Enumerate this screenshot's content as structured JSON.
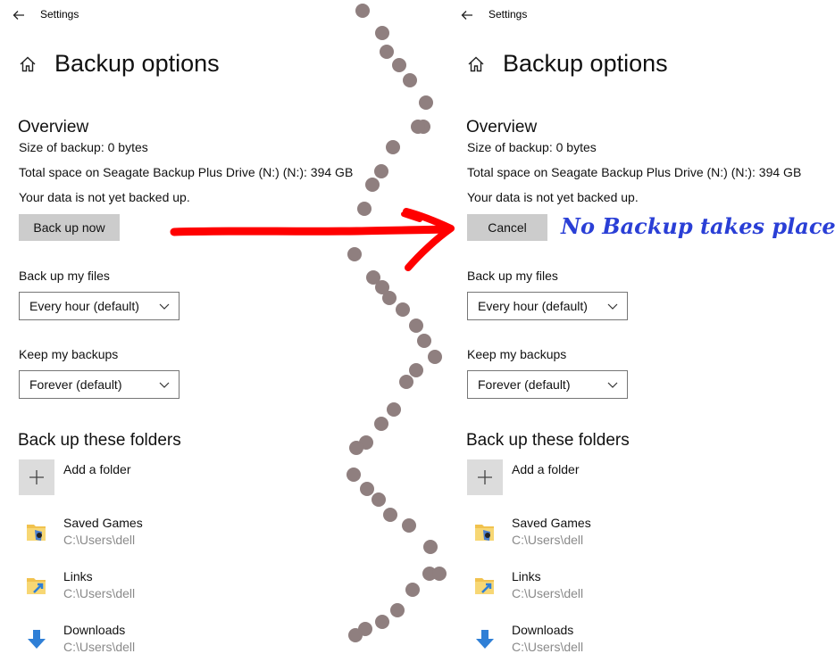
{
  "panels": {
    "left": {
      "app_title": "Settings",
      "page_title": "Backup options",
      "overview_title": "Overview",
      "size_of_backup": "Size of backup: 0 bytes",
      "total_space": "Total space on Seagate Backup Plus Drive (N:) (N:): 394 GB",
      "status": "Your data is not yet backed up.",
      "action_button": "Back up now",
      "backup_files_label": "Back up my files",
      "backup_files_value": "Every hour (default)",
      "keep_backups_label": "Keep my backups",
      "keep_backups_value": "Forever (default)",
      "folders_title": "Back up these folders",
      "add_folder": "Add a folder",
      "folders": [
        {
          "name": "Saved Games",
          "path": "C:\\Users\\dell"
        },
        {
          "name": "Links",
          "path": "C:\\Users\\dell"
        },
        {
          "name": "Downloads",
          "path": "C:\\Users\\dell"
        }
      ]
    },
    "right": {
      "app_title": "Settings",
      "page_title": "Backup options",
      "overview_title": "Overview",
      "size_of_backup": "Size of backup: 0 bytes",
      "total_space": "Total space on Seagate Backup Plus Drive (N:) (N:): 394 GB",
      "status": "Your data is not yet backed up.",
      "action_button": "Cancel",
      "backup_files_label": "Back up my files",
      "backup_files_value": "Every hour (default)",
      "keep_backups_label": "Keep my backups",
      "keep_backups_value": "Forever (default)",
      "folders_title": "Back up these folders",
      "add_folder": "Add a folder",
      "folders": [
        {
          "name": "Saved Games",
          "path": "C:\\Users\\dell"
        },
        {
          "name": "Links",
          "path": "C:\\Users\\dell"
        },
        {
          "name": "Downloads",
          "path": "C:\\Users\\dell"
        }
      ]
    }
  },
  "annotation": "No Backup takes place.",
  "colors": {
    "arrow": "#ff0000",
    "annotation": "#2a3fd6",
    "divider_dots": "#8f7f7f",
    "button_bg": "#cccccc"
  }
}
